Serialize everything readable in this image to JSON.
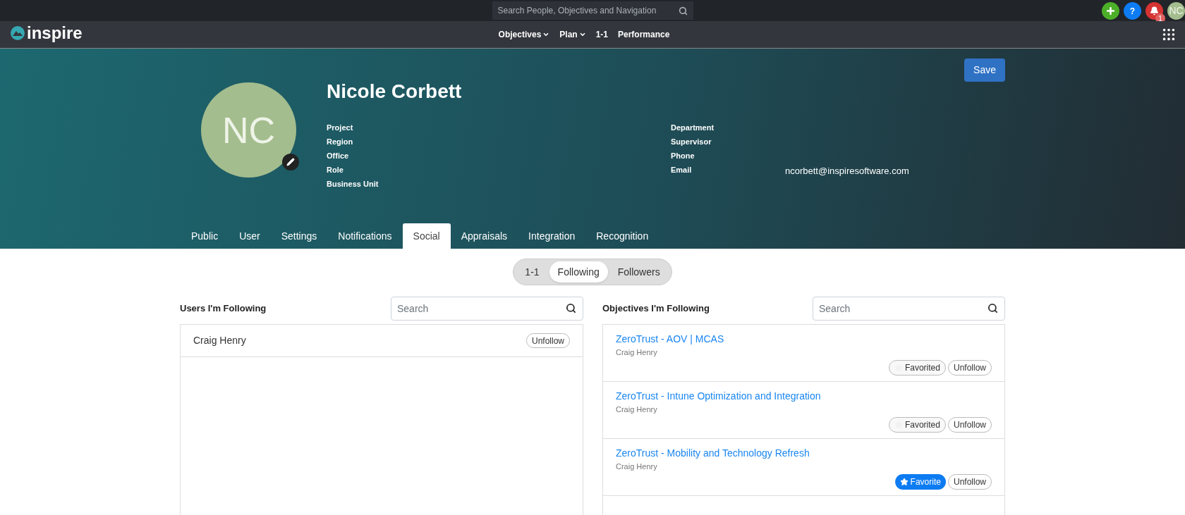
{
  "top_bar": {
    "search": {
      "placeholder": "Search People, Objectives and Navigation"
    },
    "help": "?",
    "user_initials": "NC",
    "notification_count": "1"
  },
  "nav": {
    "logo": "inspire",
    "items": [
      {
        "label": "Objectives",
        "dropdown": true
      },
      {
        "label": "Plan",
        "dropdown": true
      },
      {
        "label": "1-1",
        "dropdown": false
      },
      {
        "label": "Performance",
        "dropdown": false
      }
    ]
  },
  "profile": {
    "initials": "NC",
    "name": "Nicole Corbett",
    "save": "Save",
    "fields_left": [
      {
        "label": "Project"
      },
      {
        "label": "Region"
      },
      {
        "label": "Office"
      },
      {
        "label": "Role"
      },
      {
        "label": "Business Unit"
      }
    ],
    "fields_right": [
      {
        "label": "Department"
      },
      {
        "label": "Supervisor"
      },
      {
        "label": "Phone"
      },
      {
        "label": "Email",
        "value": "ncorbett@inspiresoftware.com"
      }
    ]
  },
  "tabs": [
    {
      "label": "Public",
      "selected": false
    },
    {
      "label": "User",
      "selected": false
    },
    {
      "label": "Settings",
      "selected": false
    },
    {
      "label": "Notifications",
      "selected": false
    },
    {
      "label": "Social",
      "selected": true
    },
    {
      "label": "Appraisals",
      "selected": false
    },
    {
      "label": "Integration",
      "selected": false
    },
    {
      "label": "Recognition",
      "selected": false
    }
  ],
  "segments": [
    {
      "label": "1-1",
      "selected": false
    },
    {
      "label": "Following",
      "selected": true
    },
    {
      "label": "Followers",
      "selected": false
    }
  ],
  "users_panel": {
    "title": "Users I'm Following",
    "search": {
      "placeholder": "Search"
    },
    "users": [
      {
        "name": "Craig Henry",
        "unfollow": "Unfollow"
      }
    ]
  },
  "objectives_panel": {
    "title": "Objectives I'm Following",
    "search": {
      "placeholder": "Search"
    },
    "objectives": [
      {
        "title": "ZeroTrust - AOV | MCAS",
        "owner": "Craig Henry",
        "favorite": "Favorited",
        "favorited": true,
        "unfollow": "Unfollow"
      },
      {
        "title": "ZeroTrust - Intune Optimization and Integration",
        "owner": "Craig Henry",
        "favorite": "Favorited",
        "favorited": true,
        "unfollow": "Unfollow"
      },
      {
        "title": "ZeroTrust - Mobility and Technology Refresh",
        "owner": "Craig Henry",
        "favorite": "Favorite",
        "favorited": false,
        "unfollow": "Unfollow"
      }
    ]
  }
}
